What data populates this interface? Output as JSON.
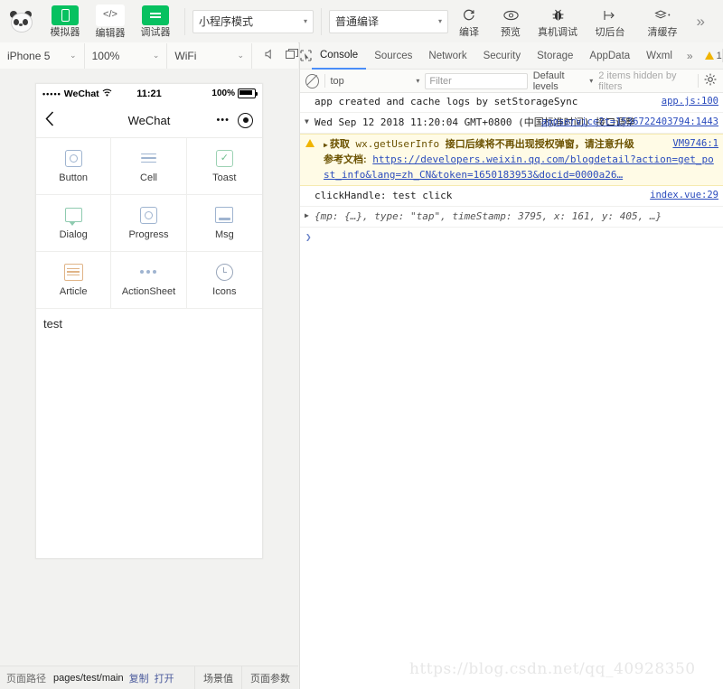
{
  "toolbar": {
    "logo": "panda-logo",
    "buttons": [
      {
        "label": "模拟器",
        "icon": "phone-icon",
        "state": "active"
      },
      {
        "label": "编辑器",
        "icon": "code-icon",
        "state": "inactive"
      },
      {
        "label": "调试器",
        "icon": "debugger-icon",
        "state": "active"
      }
    ],
    "mode_select": {
      "value": "小程序模式",
      "caret": "▾"
    },
    "compile_select": {
      "value": "普通编译",
      "caret": "▾"
    },
    "actions": [
      {
        "label": "编译",
        "icon": "refresh-icon",
        "glyph": "⟳"
      },
      {
        "label": "预览",
        "icon": "eye-icon",
        "glyph": "◉"
      },
      {
        "label": "真机调试",
        "icon": "bug-icon",
        "glyph": "🐞"
      },
      {
        "label": "切后台",
        "icon": "background-icon",
        "glyph": "⇥"
      },
      {
        "label": "清缓存",
        "icon": "layers-icon",
        "glyph": "≋"
      }
    ],
    "overflow": "»"
  },
  "device_bar": {
    "device": {
      "value": "iPhone 5",
      "caret": "⌄"
    },
    "zoom": {
      "value": "100%",
      "caret": "⌄"
    },
    "network": {
      "value": "WiFi",
      "caret": "⌄"
    },
    "mute_icon": "mute-icon",
    "detach_icon": "detach-icon"
  },
  "simulator": {
    "status_bar": {
      "signal_dots": "•••••",
      "carrier": "WeChat",
      "wifi_icon": "wifi-icon",
      "time": "11:21",
      "battery_text": "100%"
    },
    "nav_bar": {
      "back_icon": "back-chevron-icon",
      "title": "WeChat",
      "capsule_more": "•••",
      "capsule_target": "target-icon"
    },
    "grid": [
      {
        "label": "Button",
        "icon": "rounded-square-ring-icon"
      },
      {
        "label": "Cell",
        "icon": "list-lines-icon"
      },
      {
        "label": "Toast",
        "icon": "check-square-icon"
      },
      {
        "label": "Dialog",
        "icon": "speech-bubble-icon"
      },
      {
        "label": "Progress",
        "icon": "rounded-square-ring-icon"
      },
      {
        "label": "Msg",
        "icon": "message-box-icon"
      },
      {
        "label": "Article",
        "icon": "document-icon"
      },
      {
        "label": "ActionSheet",
        "icon": "three-dots-icon"
      },
      {
        "label": "Icons",
        "icon": "clock-icon"
      }
    ],
    "body_text": "test"
  },
  "status_bar": {
    "path_label": "页面路径",
    "path_value": "pages/test/main",
    "copy_label": "复制",
    "open_label": "打开",
    "scene_label": "场景值",
    "params_label": "页面参数"
  },
  "devtools": {
    "inspect_icon": "inspect-cursor-icon",
    "tabs": [
      {
        "label": "Console",
        "active": true
      },
      {
        "label": "Sources",
        "active": false
      },
      {
        "label": "Network",
        "active": false
      },
      {
        "label": "Security",
        "active": false
      },
      {
        "label": "Storage",
        "active": false
      },
      {
        "label": "AppData",
        "active": false
      },
      {
        "label": "Wxml",
        "active": false
      }
    ],
    "tabs_overflow": "»",
    "warning_count": "1",
    "kebab_icon": "more-vertical-icon",
    "dock_icon": "dock-icon",
    "filters": {
      "clear_icon": "clear-console-icon",
      "context": "top",
      "context_caret": "▾",
      "filter_placeholder": "Filter",
      "levels": "Default levels",
      "levels_caret": "▾",
      "hidden_info": "2 items hidden by filters",
      "settings_icon": "gear-icon"
    },
    "console": {
      "entries": [
        {
          "kind": "log",
          "text": "app created and cache logs by setStorageSync",
          "source": "app.js:100"
        },
        {
          "kind": "log-expandable",
          "arrow": "▼",
          "text": "Wed Sep 12 2018 11:20:04 GMT+0800 (中国标准时间) 接口调整",
          "source": "appservice?t=1536722403794:1443"
        },
        {
          "kind": "warning",
          "arrow": "▶",
          "text_prefix": "获取",
          "text_code": "wx.getUserInfo",
          "text_suffix": "接口后续将不再出现授权弹窗，请注意升级",
          "doc_label": "参考文档:",
          "doc_url": "https://developers.weixin.qq.com/blogdetail?action=get_post_info&lang=zh_CN&token=1650183953&docid=0000a26…",
          "source": "VM9746:1"
        },
        {
          "kind": "log",
          "text": "clickHandle: test click",
          "source": "index.vue:29"
        },
        {
          "kind": "object",
          "arrow": "▶",
          "text": "{mp: {…}, type: \"tap\", timeStamp: 3795, x: 161, y: 405, …}"
        }
      ],
      "prompt_chevron": "❯"
    }
  },
  "watermark": "https://blog.csdn.net/qq_40928350",
  "colors": {
    "accent_green": "#07c160",
    "tab_active": "#4a8df8",
    "warning": "#f0b400",
    "link": "#2a4bbd"
  }
}
